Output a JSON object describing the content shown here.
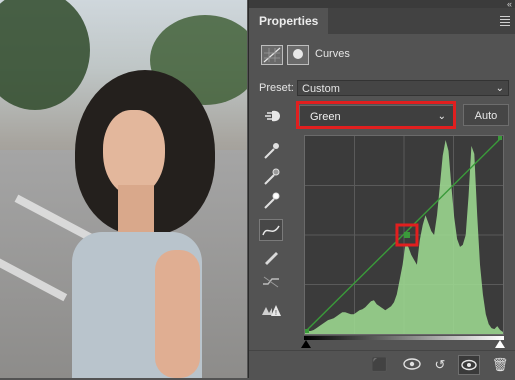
{
  "panel": {
    "tab_label": "Properties",
    "collapse_glyph": "«",
    "header_label": "Curves",
    "preset_label": "Preset:",
    "preset_value": "Custom",
    "channel_value": "Green",
    "auto_label": "Auto"
  },
  "curve": {
    "channel_color": "#9bd68f",
    "line_color": "#3a9a3a",
    "highlight_color": "#e11f1f",
    "histogram": [
      2,
      3,
      3,
      4,
      6,
      8,
      10,
      12,
      14,
      15,
      16,
      18,
      20,
      22,
      22,
      21,
      20,
      20,
      22,
      24,
      25,
      27,
      30,
      33,
      34,
      30,
      28,
      26,
      24,
      26,
      28,
      32,
      40,
      55,
      70,
      90,
      88,
      80,
      75,
      70,
      95,
      110,
      120,
      112,
      104,
      100,
      120,
      150,
      180,
      196,
      185,
      150,
      118,
      96,
      88,
      90,
      100,
      140,
      190,
      182,
      120,
      70,
      40,
      20,
      10,
      6,
      5,
      8,
      4,
      2
    ]
  },
  "icons": {
    "targeted_adjust": "hand-targeted-icon",
    "black_eyedropper": "eyedropper-black-icon",
    "gray_eyedropper": "eyedropper-gray-icon",
    "white_eyedropper": "eyedropper-white-icon",
    "curve_tool": "curve-points-icon",
    "pencil_tool": "pencil-icon",
    "smooth_tool": "smooth-icon",
    "clipping_warning": "clipping-warning-icon",
    "clip_to_layer": "clip-to-layer-icon",
    "view_previous": "view-previous-icon",
    "reset": "reset-icon",
    "visibility": "eye-icon",
    "delete": "trash-icon"
  }
}
